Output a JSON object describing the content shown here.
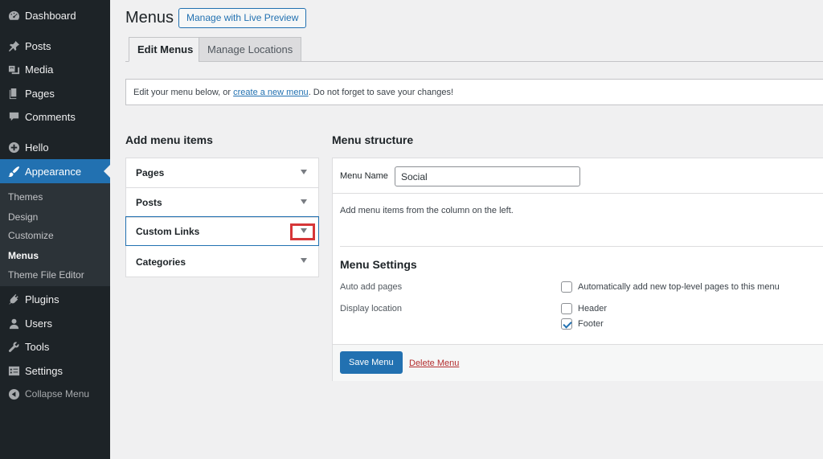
{
  "sidebar": {
    "items": [
      {
        "label": "Dashboard",
        "icon": "dashboard-icon"
      },
      {
        "label": "Posts",
        "icon": "pin-icon"
      },
      {
        "label": "Media",
        "icon": "media-icon"
      },
      {
        "label": "Pages",
        "icon": "pages-icon"
      },
      {
        "label": "Comments",
        "icon": "comments-icon"
      },
      {
        "label": "Hello",
        "icon": "plus-circle-icon"
      },
      {
        "label": "Appearance",
        "icon": "paintbrush-icon"
      },
      {
        "label": "Plugins",
        "icon": "plugins-icon"
      },
      {
        "label": "Users",
        "icon": "users-icon"
      },
      {
        "label": "Tools",
        "icon": "wrench-icon"
      },
      {
        "label": "Settings",
        "icon": "settings-icon"
      }
    ],
    "submenu": [
      {
        "label": "Themes"
      },
      {
        "label": "Design"
      },
      {
        "label": "Customize"
      },
      {
        "label": "Menus"
      },
      {
        "label": "Theme File Editor"
      }
    ],
    "collapse_label": "Collapse Menu"
  },
  "header": {
    "title": "Menus",
    "live_preview_label": "Manage with Live Preview"
  },
  "tabs": [
    {
      "label": "Edit Menus"
    },
    {
      "label": "Manage Locations"
    }
  ],
  "notice": {
    "prefix": "Edit your menu below, or ",
    "link": "create a new menu",
    "suffix": ". Do not forget to save your changes!"
  },
  "add_items": {
    "heading": "Add menu items",
    "sections": [
      {
        "label": "Pages"
      },
      {
        "label": "Posts"
      },
      {
        "label": "Custom Links"
      },
      {
        "label": "Categories"
      }
    ]
  },
  "structure": {
    "heading": "Menu structure",
    "menu_name_label": "Menu Name",
    "menu_name_value": "Social",
    "instructions": "Add menu items from the column on the left.",
    "settings_title": "Menu Settings",
    "auto_add_label": "Auto add pages",
    "auto_add_option": "Automatically add new top-level pages to this menu",
    "display_location_label": "Display location",
    "locations": [
      {
        "label": "Header",
        "checked": false
      },
      {
        "label": "Footer",
        "checked": true
      }
    ],
    "save_label": "Save Menu",
    "delete_label": "Delete Menu"
  },
  "colors": {
    "accent": "#2271b1",
    "sidebar_bg": "#1d2327",
    "highlight": "#d63638"
  }
}
